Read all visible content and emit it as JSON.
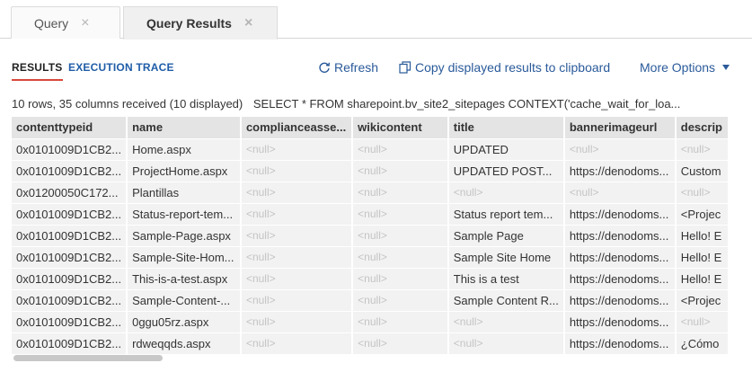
{
  "tabs": [
    {
      "label": "Query"
    },
    {
      "label": "Query Results"
    }
  ],
  "close_glyph": "×",
  "subtabs": {
    "results": "RESULTS",
    "trace": "EXECUTION TRACE"
  },
  "actions": {
    "refresh": "Refresh",
    "copy": "Copy displayed results to clipboard",
    "more": "More Options"
  },
  "summary": {
    "counts": "10 rows, 35 columns received (10 displayed)",
    "sql": "SELECT * FROM sharepoint.bv_site2_sitepages CONTEXT('cache_wait_for_loa..."
  },
  "table": {
    "null_text": "<null>",
    "columns": [
      "contenttypeid",
      "name",
      "complianceasse...",
      "wikicontent",
      "title",
      "bannerimageurl",
      "descrip"
    ],
    "rows": [
      [
        "0x0101009D1CB2...",
        "Home.aspx",
        null,
        null,
        "UPDATED",
        null,
        null
      ],
      [
        "0x0101009D1CB2...",
        "ProjectHome.aspx",
        null,
        null,
        "UPDATED POST...",
        "https://denodoms...",
        "Custom"
      ],
      [
        "0x01200050C172...",
        "Plantillas",
        null,
        null,
        null,
        null,
        null
      ],
      [
        "0x0101009D1CB2...",
        "Status-report-tem...",
        null,
        null,
        "Status report tem...",
        "https://denodoms...",
        "<Projec"
      ],
      [
        "0x0101009D1CB2...",
        "Sample-Page.aspx",
        null,
        null,
        "Sample Page",
        "https://denodoms...",
        "Hello! E"
      ],
      [
        "0x0101009D1CB2...",
        "Sample-Site-Hom...",
        null,
        null,
        "Sample Site Home",
        "https://denodoms...",
        "Hello! E"
      ],
      [
        "0x0101009D1CB2...",
        "This-is-a-test.aspx",
        null,
        null,
        "This is a test",
        "https://denodoms...",
        "Hello! E"
      ],
      [
        "0x0101009D1CB2...",
        "Sample-Content-...",
        null,
        null,
        "Sample Content R...",
        "https://denodoms...",
        "<Projec"
      ],
      [
        "0x0101009D1CB2...",
        "0ggu05rz.aspx",
        null,
        null,
        null,
        "https://denodoms...",
        null
      ],
      [
        "0x0101009D1CB2...",
        "rdweqqds.aspx",
        null,
        null,
        null,
        "https://denodoms...",
        "¿Cómo"
      ]
    ]
  },
  "colors": {
    "accent_red": "#d9483b",
    "link_blue": "#2a5a9a"
  },
  "icons": {
    "refresh": "refresh-icon",
    "copy": "copy-icon",
    "more": "chevron-down-icon",
    "close": "close-icon"
  }
}
